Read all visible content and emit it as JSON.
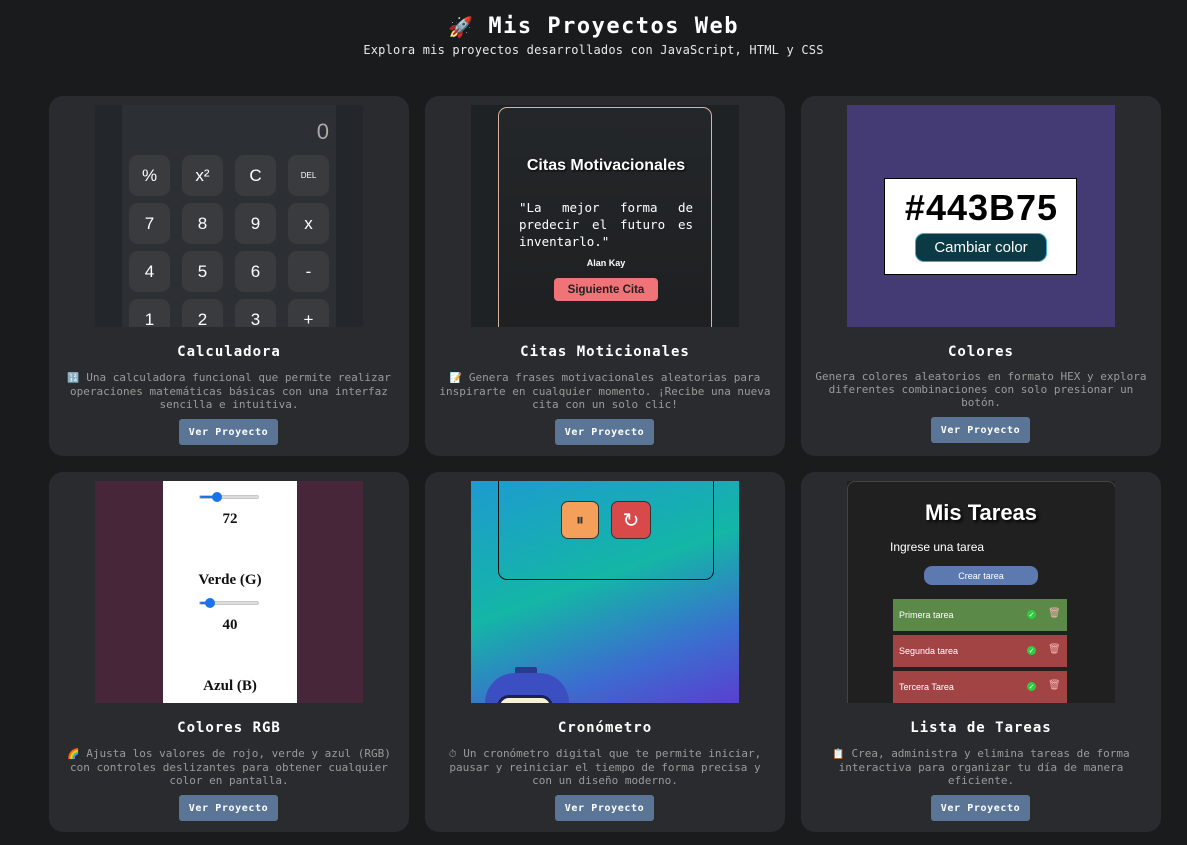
{
  "header": {
    "rocket_icon": "🚀",
    "title": "Mis Proyectos Web",
    "subtitle": "Explora mis proyectos desarrollados con JavaScript, HTML y CSS"
  },
  "projects": [
    {
      "title": "Calculadora",
      "icon": "🔢",
      "description": "Una calculadora funcional que permite realizar operaciones matemáticas básicas con una interfaz sencilla e intuitiva.",
      "button": "Ver Proyecto"
    },
    {
      "title": "Citas Moticionales",
      "icon": "📝",
      "description": "Genera frases motivacionales aleatorias para inspirarte en cualquier momento. ¡Recibe una nueva cita con un solo clic!",
      "button": "Ver Proyecto"
    },
    {
      "title": "Colores",
      "icon": "",
      "description": "Genera colores aleatorios en formato HEX y explora diferentes combinaciones con solo presionar un botón.",
      "button": "Ver Proyecto"
    },
    {
      "title": "Colores RGB",
      "icon": "🌈",
      "description": "Ajusta los valores de rojo, verde y azul (RGB) con controles deslizantes para obtener cualquier color en pantalla.",
      "button": "Ver Proyecto"
    },
    {
      "title": "Cronómetro",
      "icon": "⏱",
      "description": "Un cronómetro digital que te permite iniciar, pausar y reiniciar el tiempo de forma precisa y con un diseño moderno.",
      "button": "Ver Proyecto"
    },
    {
      "title": "Lista de Tareas",
      "icon": "📋",
      "description": "Crea, administra y elimina tareas de forma interactiva para organizar tu día de manera eficiente.",
      "button": "Ver Proyecto"
    }
  ],
  "previews": {
    "calculator": {
      "display": "0",
      "keys": [
        "%",
        "x²",
        "C",
        "DEL",
        "7",
        "8",
        "9",
        "x",
        "4",
        "5",
        "6",
        "-",
        "1",
        "2",
        "3",
        "+"
      ]
    },
    "quotes": {
      "title": "Citas Motivacionales",
      "quote": "\"La mejor forma de predecir el futuro es inventarlo.\"",
      "author": "Alan Kay",
      "button": "Siguiente Cita"
    },
    "colors": {
      "hex": "#443B75",
      "button": "Cambiar color",
      "background": "#443B75"
    },
    "rgb": {
      "red_value": "72",
      "green_label": "Verde (G)",
      "green_value": "40",
      "blue_label": "Azul (B)",
      "red_fraction": 0.28,
      "green_fraction": 0.16,
      "background": "#48263a"
    },
    "stopwatch": {
      "pause_icon": "⏸",
      "reset_icon": "↻"
    },
    "tasks": {
      "title": "Mis Tareas",
      "input_label": "Ingrese una tarea",
      "button": "Crear tarea",
      "items": [
        {
          "text": "Primera tarea",
          "status_color": "#5b8a48"
        },
        {
          "text": "Segunda tarea",
          "status_color": "#a24444"
        },
        {
          "text": "Tercera Tarea",
          "status_color": "#a24444"
        }
      ],
      "check_icon": "✓",
      "delete_icon": "🗑"
    }
  }
}
